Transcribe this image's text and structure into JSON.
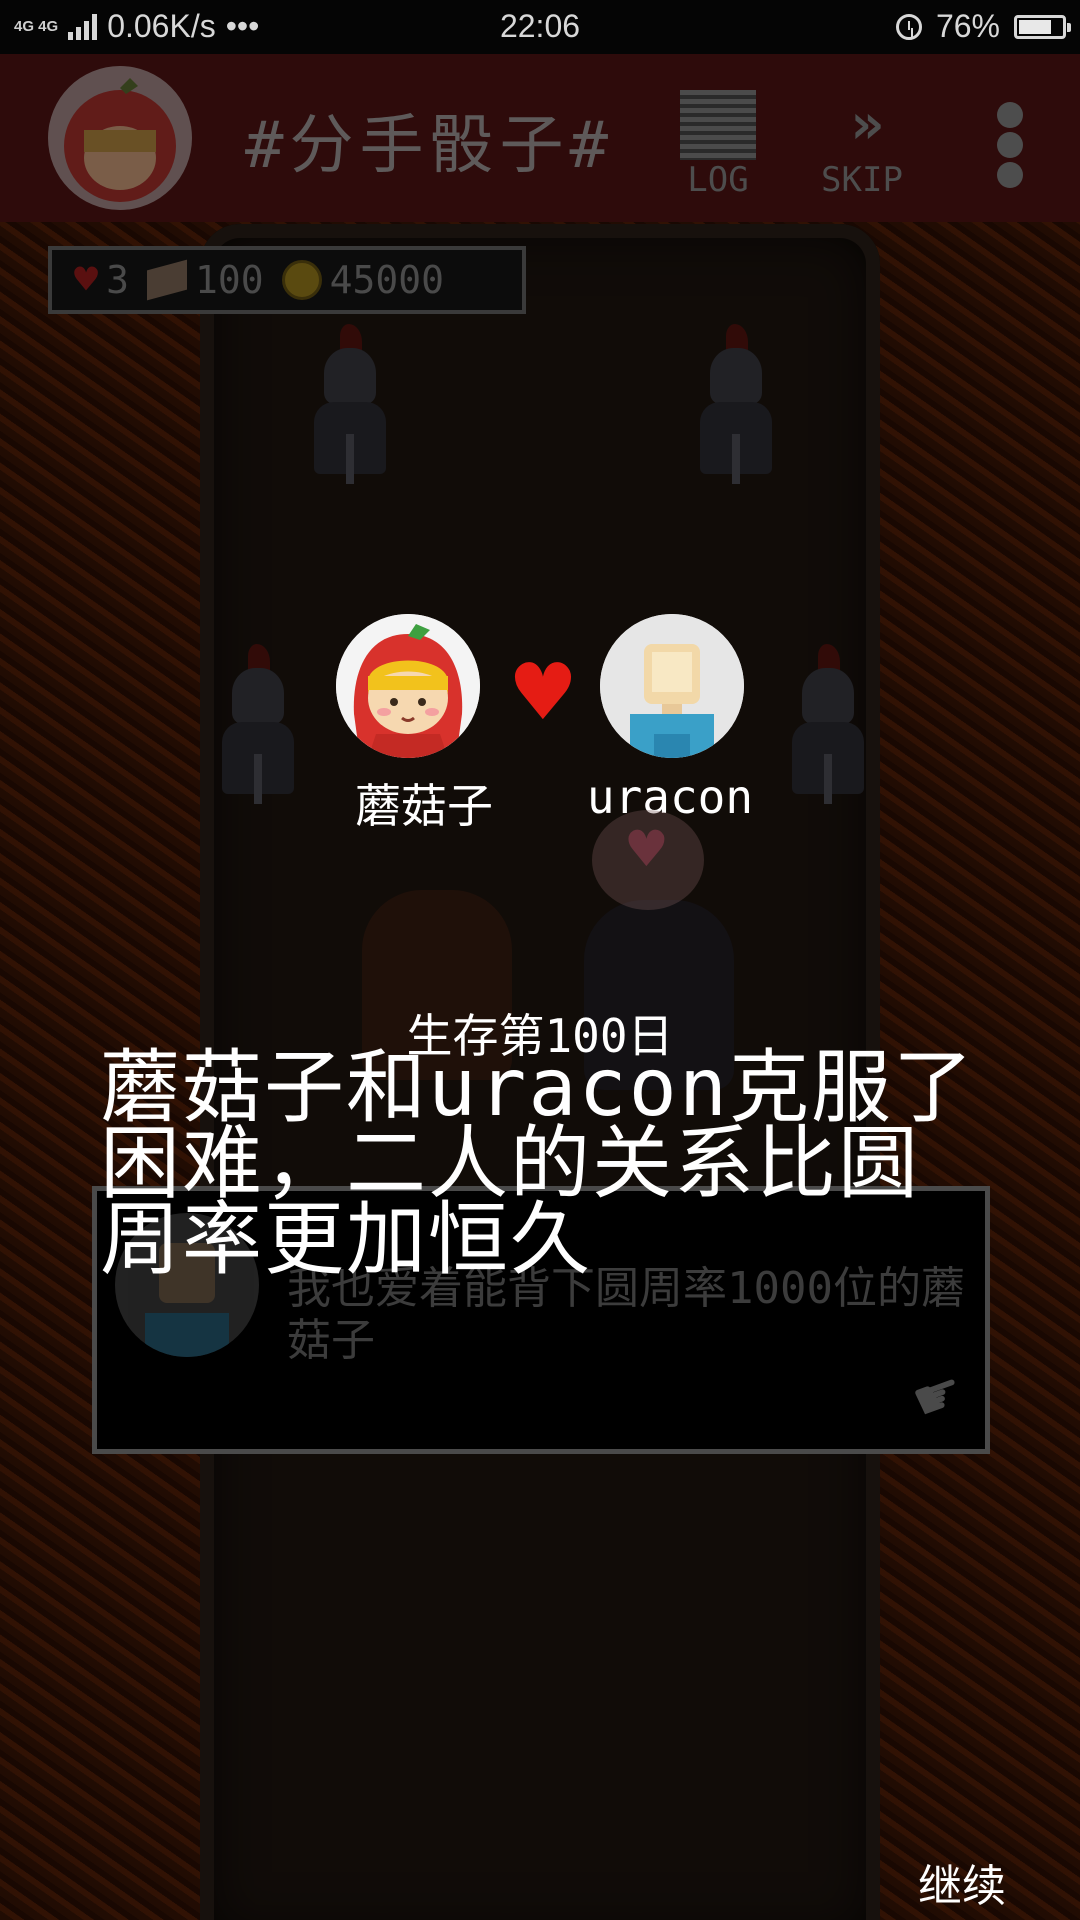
{
  "status_bar": {
    "network": "4G 4G",
    "speed": "0.06K/s",
    "more": "•••",
    "time": "22:06",
    "battery_text": "76%",
    "battery_level": 0.76
  },
  "header": {
    "title": "#分手骰子#",
    "log_label": "LOG",
    "skip_label": "SKIP"
  },
  "stats": {
    "hearts": "3",
    "items": "100",
    "coins": "45000"
  },
  "couple": {
    "left_name": "蘑菇子",
    "right_name": "uracon"
  },
  "announcement": {
    "day": "生存第100日",
    "message": "蘑菇子和uracon克服了困难，二人的关系比圆周率更加恒久"
  },
  "dialog": {
    "text": "我也爱着能背下圆周率1000位的蘑菇子"
  },
  "continue_label": "继续",
  "colors": {
    "heart": "#e51c14",
    "header_bg": "#2e0b0b",
    "hood_red": "#d8322c",
    "shirt_blue": "#3aa0c8"
  }
}
